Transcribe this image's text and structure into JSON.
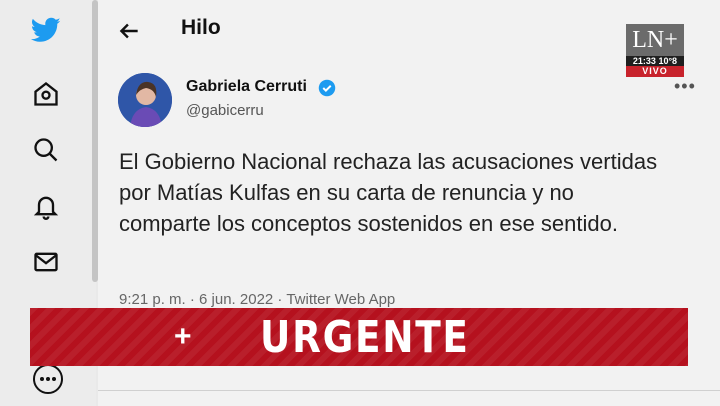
{
  "header": {
    "title": "Hilo"
  },
  "tweet": {
    "author_name": "Gabriela Cerruti",
    "handle": "@gabicerru",
    "text": "El Gobierno Nacional rechaza las acusaciones vertidas por Matías Kulfas en su carta de renuncia y no comparte los conceptos sostenidos en ese sentido.",
    "meta": "9:21 p. m. · 6 jun. 2022 · Twitter Web App",
    "more": "•••"
  },
  "broadcast": {
    "logo": "LN+",
    "clock": "21:33 10°8",
    "live": "VIVO",
    "banner_plus": "+",
    "banner_text": "URGENTE"
  },
  "colors": {
    "twitter_blue": "#1d9bf0",
    "banner_red": "#b5111e",
    "vivo_red": "#c8232c"
  },
  "icons": {
    "sidebar": [
      "twitter-logo-icon",
      "home-icon",
      "search-icon",
      "bell-icon",
      "mail-icon",
      "more-circle-icon"
    ]
  }
}
